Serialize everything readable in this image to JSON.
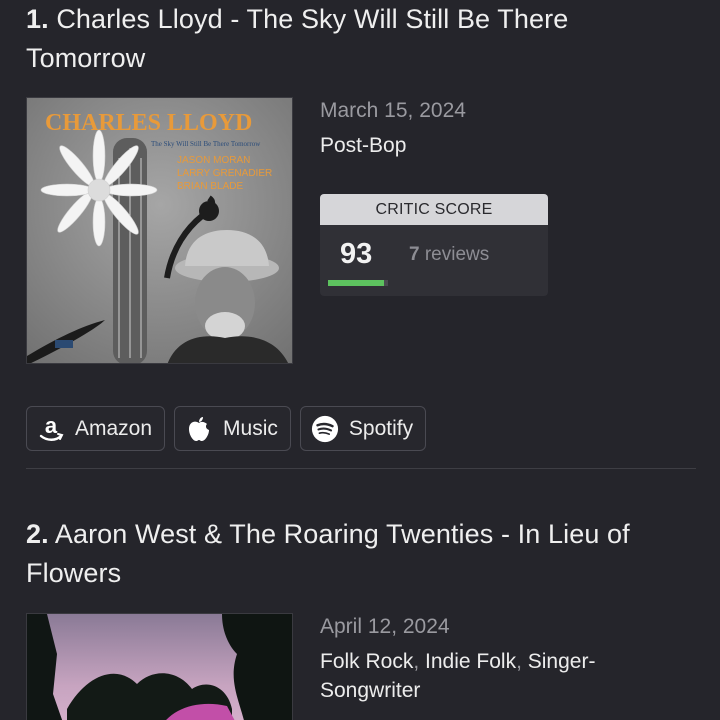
{
  "entries": [
    {
      "rank": "1.",
      "title": "Charles Lloyd - The Sky Will Still Be There Tomorrow",
      "release_date": "March 15, 2024",
      "genres": [
        "Post-Bop"
      ],
      "critic": {
        "header": "CRITIC SCORE",
        "score": "93",
        "review_count": "7",
        "review_word": "reviews",
        "score_fraction": 0.93,
        "bar_color": "#5dc25f"
      },
      "cover": {
        "artist_text": "CHARLES LLOYD",
        "subtitle_text": "The Sky Will Still Be There Tomorrow",
        "personnel": [
          "JASON MORAN",
          "LARRY GRENADIER",
          "BRIAN BLADE"
        ],
        "accent_color": "#e89a3a"
      },
      "links": [
        {
          "label": "Amazon",
          "icon": "amazon-icon"
        },
        {
          "label": "Music",
          "icon": "apple-icon"
        },
        {
          "label": "Spotify",
          "icon": "spotify-icon"
        }
      ]
    },
    {
      "rank": "2.",
      "title": "Aaron West & The Roaring Twenties - In Lieu of Flowers",
      "release_date": "April 12, 2024",
      "genres": [
        "Folk Rock",
        "Indie Folk",
        "Singer-Songwriter"
      ]
    }
  ]
}
